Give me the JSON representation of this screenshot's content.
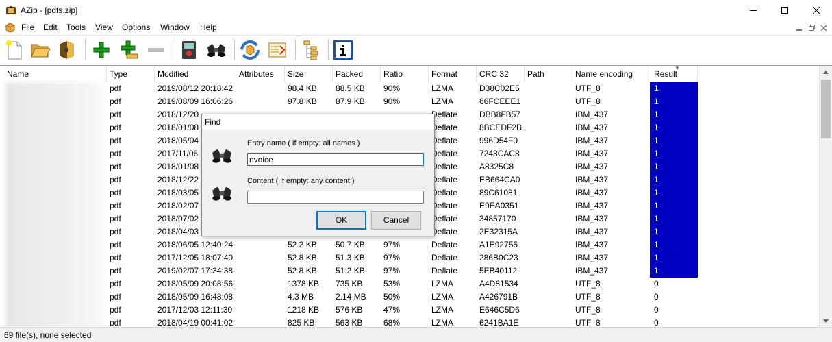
{
  "window": {
    "title": "AZip - [pdfs.zip]"
  },
  "menu": [
    "File",
    "Edit",
    "Tools",
    "View",
    "Options",
    "Window",
    "Help"
  ],
  "toolbar": {
    "buttons": [
      "new-archive",
      "open-archive",
      "close-archive",
      "add-files",
      "add-folder",
      "delete-entries",
      "test-archive",
      "find-in-archive",
      "update-archive",
      "recompress-archive",
      "tree-view",
      "properties"
    ]
  },
  "columns": [
    "Name",
    "Type",
    "Modified",
    "Attributes",
    "Size",
    "Packed",
    "Ratio",
    "Format",
    "CRC 32",
    "Path",
    "Name encoding",
    "Result"
  ],
  "rows": [
    {
      "type": "pdf",
      "modified": "2019/08/12  20:18:42",
      "size": "98.4 KB",
      "packed": "88.5 KB",
      "ratio": "90%",
      "format": "LZMA",
      "crc": "D38C02E5",
      "encoding": "UTF_8",
      "result": "1",
      "hit": true
    },
    {
      "type": "pdf",
      "modified": "2019/08/09  16:06:26",
      "size": "97.8 KB",
      "packed": "87.9 KB",
      "ratio": "90%",
      "format": "LZMA",
      "crc": "66FCEEE1",
      "encoding": "UTF_8",
      "result": "1",
      "hit": true
    },
    {
      "type": "pdf",
      "modified": "2018/12/20",
      "size": "",
      "packed": "",
      "ratio": "",
      "format": "Deflate",
      "crc": "DBB8FB57",
      "encoding": "IBM_437",
      "result": "1",
      "hit": true
    },
    {
      "type": "pdf",
      "modified": "2018/01/08",
      "size": "",
      "packed": "",
      "ratio": "",
      "format": "Deflate",
      "crc": "8BCEDF2B",
      "encoding": "IBM_437",
      "result": "1",
      "hit": true
    },
    {
      "type": "pdf",
      "modified": "2018/05/04",
      "size": "",
      "packed": "",
      "ratio": "",
      "format": "Deflate",
      "crc": "996D54F0",
      "encoding": "IBM_437",
      "result": "1",
      "hit": true
    },
    {
      "type": "pdf",
      "modified": "2017/11/06",
      "size": "",
      "packed": "",
      "ratio": "",
      "format": "Deflate",
      "crc": "7248CAC8",
      "encoding": "IBM_437",
      "result": "1",
      "hit": true
    },
    {
      "type": "pdf",
      "modified": "2018/01/08",
      "size": "",
      "packed": "",
      "ratio": "",
      "format": "Deflate",
      "crc": "A8325C8",
      "encoding": "IBM_437",
      "result": "1",
      "hit": true
    },
    {
      "type": "pdf",
      "modified": "2018/12/22",
      "size": "",
      "packed": "",
      "ratio": "",
      "format": "Deflate",
      "crc": "EB664CA0",
      "encoding": "IBM_437",
      "result": "1",
      "hit": true
    },
    {
      "type": "pdf",
      "modified": "2018/03/05",
      "size": "",
      "packed": "",
      "ratio": "",
      "format": "Deflate",
      "crc": "89C61081",
      "encoding": "IBM_437",
      "result": "1",
      "hit": true
    },
    {
      "type": "pdf",
      "modified": "2018/02/07",
      "size": "",
      "packed": "",
      "ratio": "",
      "format": "Deflate",
      "crc": "E9EA0351",
      "encoding": "IBM_437",
      "result": "1",
      "hit": true
    },
    {
      "type": "pdf",
      "modified": "2018/07/02",
      "size": "",
      "packed": "",
      "ratio": "",
      "format": "Deflate",
      "crc": "34857170",
      "encoding": "IBM_437",
      "result": "1",
      "hit": true
    },
    {
      "type": "pdf",
      "modified": "2018/04/03",
      "size": "",
      "packed": "",
      "ratio": "",
      "format": "Deflate",
      "crc": "2E32315A",
      "encoding": "IBM_437",
      "result": "1",
      "hit": true
    },
    {
      "type": "pdf",
      "modified": "2018/06/05  12:40:24",
      "size": "52.2 KB",
      "packed": "50.7 KB",
      "ratio": "97%",
      "format": "Deflate",
      "crc": "A1E92755",
      "encoding": "IBM_437",
      "result": "1",
      "hit": true
    },
    {
      "type": "pdf",
      "modified": "2017/12/05  18:07:40",
      "size": "52.8 KB",
      "packed": "51.3 KB",
      "ratio": "97%",
      "format": "Deflate",
      "crc": "286B0C23",
      "encoding": "IBM_437",
      "result": "1",
      "hit": true
    },
    {
      "type": "pdf",
      "modified": "2019/02/07  17:34:38",
      "size": "52.8 KB",
      "packed": "51.2 KB",
      "ratio": "97%",
      "format": "Deflate",
      "crc": "5EB40112",
      "encoding": "IBM_437",
      "result": "1",
      "hit": true
    },
    {
      "type": "pdf",
      "modified": "2018/05/09  20:08:56",
      "size": "1378 KB",
      "packed": "735 KB",
      "ratio": "53%",
      "format": "LZMA",
      "crc": "A4D81534",
      "encoding": "UTF_8",
      "result": "0",
      "hit": false
    },
    {
      "type": "pdf",
      "modified": "2018/05/09  16:48:08",
      "size": "4.3 MB",
      "packed": "2.14 MB",
      "ratio": "50%",
      "format": "LZMA",
      "crc": "A426791B",
      "encoding": "UTF_8",
      "result": "0",
      "hit": false
    },
    {
      "type": "pdf",
      "modified": "2017/12/03  12:11:30",
      "size": "1218 KB",
      "packed": "576 KB",
      "ratio": "47%",
      "format": "LZMA",
      "crc": "E646C5D6",
      "encoding": "UTF_8",
      "result": "0",
      "hit": false
    },
    {
      "type": "pdf",
      "modified": "2018/04/19  00:41:02",
      "size": "825 KB",
      "packed": "563 KB",
      "ratio": "68%",
      "format": "LZMA",
      "crc": "6241BA1E",
      "encoding": "UTF_8",
      "result": "0",
      "hit": false
    }
  ],
  "status": "69 file(s), none selected",
  "dialog": {
    "title": "Find",
    "entry_label": "Entry name ( if empty: all names )",
    "entry_value": "nvoice",
    "content_label": "Content ( if empty: any content )",
    "content_value": "",
    "ok": "OK",
    "cancel": "Cancel"
  },
  "colors": {
    "result_highlight": "#0000c0",
    "focus": "#0078d7"
  }
}
